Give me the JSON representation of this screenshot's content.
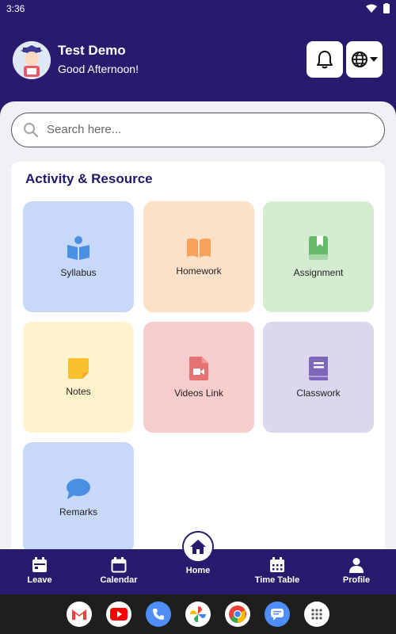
{
  "status_bar": {
    "time": "3:36"
  },
  "header": {
    "user_name": "Test Demo",
    "greeting": "Good Afternoon!"
  },
  "search": {
    "placeholder": "Search here..."
  },
  "section": {
    "title": "Activity & Resource",
    "tiles": [
      {
        "label": "Syllabus",
        "icon": "reading-book-icon",
        "bg": "#c8d8f8",
        "fg": "#4a90e2"
      },
      {
        "label": "Homework",
        "icon": "open-book-icon",
        "bg": "#fde0c8",
        "fg": "#f5a25d"
      },
      {
        "label": "Assignment",
        "icon": "bookmark-book-icon",
        "bg": "#d6ecd2",
        "fg": "#66bb6a"
      },
      {
        "label": "Notes",
        "icon": "sticky-note-icon",
        "bg": "#fff3cd",
        "fg": "#fbc02d"
      },
      {
        "label": "Videos Link",
        "icon": "video-file-icon",
        "bg": "#f6cccc",
        "fg": "#e57373"
      },
      {
        "label": "Classwork",
        "icon": "book-icon",
        "bg": "#dcd6ef",
        "fg": "#7e67b8"
      },
      {
        "label": "Remarks",
        "icon": "chat-bubble-icon",
        "bg": "#c8d8f8",
        "fg": "#4a90e2"
      }
    ]
  },
  "bottom_nav": {
    "items": [
      {
        "label": "Leave",
        "icon": "leave-calendar-icon"
      },
      {
        "label": "Calendar",
        "icon": "calendar-icon"
      },
      {
        "label": "Home",
        "icon": "home-icon"
      },
      {
        "label": "Time Table",
        "icon": "timetable-icon"
      },
      {
        "label": "Profile",
        "icon": "person-icon"
      }
    ]
  },
  "dock": {
    "apps": [
      "gmail-icon",
      "youtube-icon",
      "phone-icon",
      "photos-icon",
      "chrome-icon",
      "messages-icon",
      "app-drawer-icon"
    ]
  },
  "colors": {
    "primary": "#2a1a6e",
    "page_bg": "#f1f1f5"
  }
}
